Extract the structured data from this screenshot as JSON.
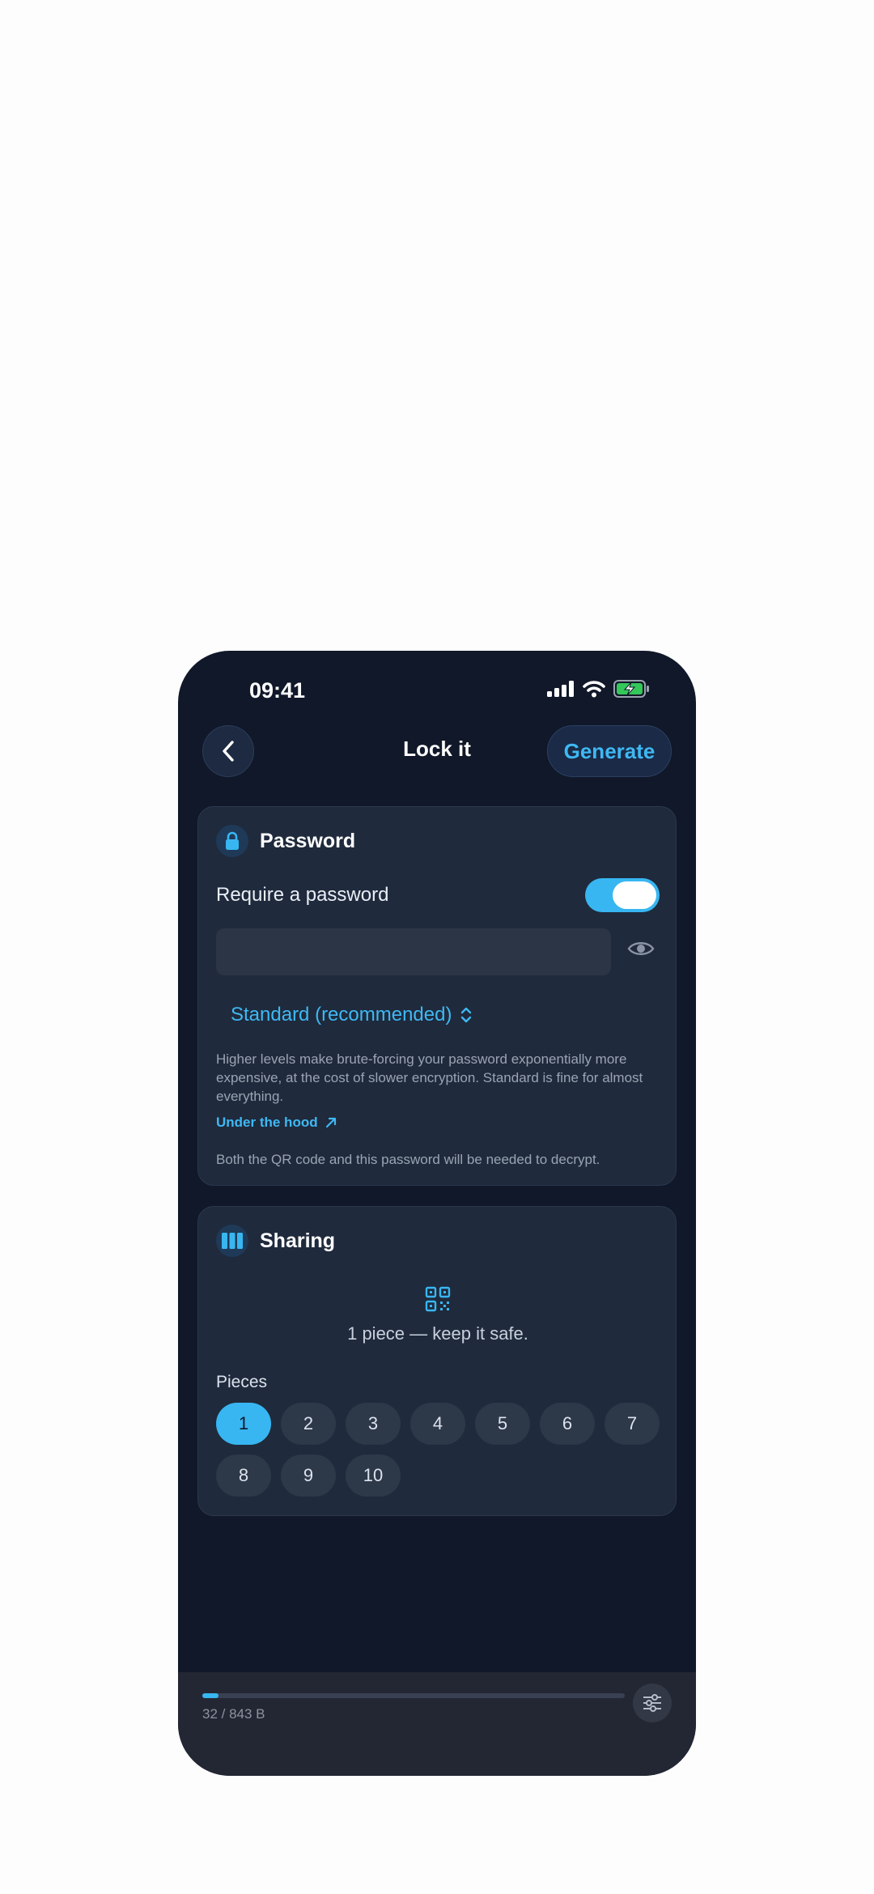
{
  "status": {
    "time": "09:41"
  },
  "header": {
    "title": "Lock it",
    "generate_label": "Generate"
  },
  "password_card": {
    "title": "Password",
    "require_label": "Require a password",
    "require_enabled": true,
    "input_value": "",
    "level_label": "Standard (recommended)",
    "help_text": "Higher levels make brute-forcing your password exponentially more expensive, at the cost of slower encryption. Standard is fine for almost everything.",
    "link_label": "Under the hood",
    "note": "Both the QR code and this password will be needed to decrypt."
  },
  "sharing_card": {
    "title": "Sharing",
    "message": "1 piece — keep it safe.",
    "pieces_label": "Pieces",
    "options": [
      "1",
      "2",
      "3",
      "4",
      "5",
      "6",
      "7",
      "8",
      "9",
      "10"
    ],
    "selected": "1"
  },
  "footer": {
    "size_text": "32 / 843 B",
    "progress": 0.038
  },
  "colors": {
    "accent": "#38b6f1",
    "background": "#101829",
    "card": "#1f2a3c"
  }
}
